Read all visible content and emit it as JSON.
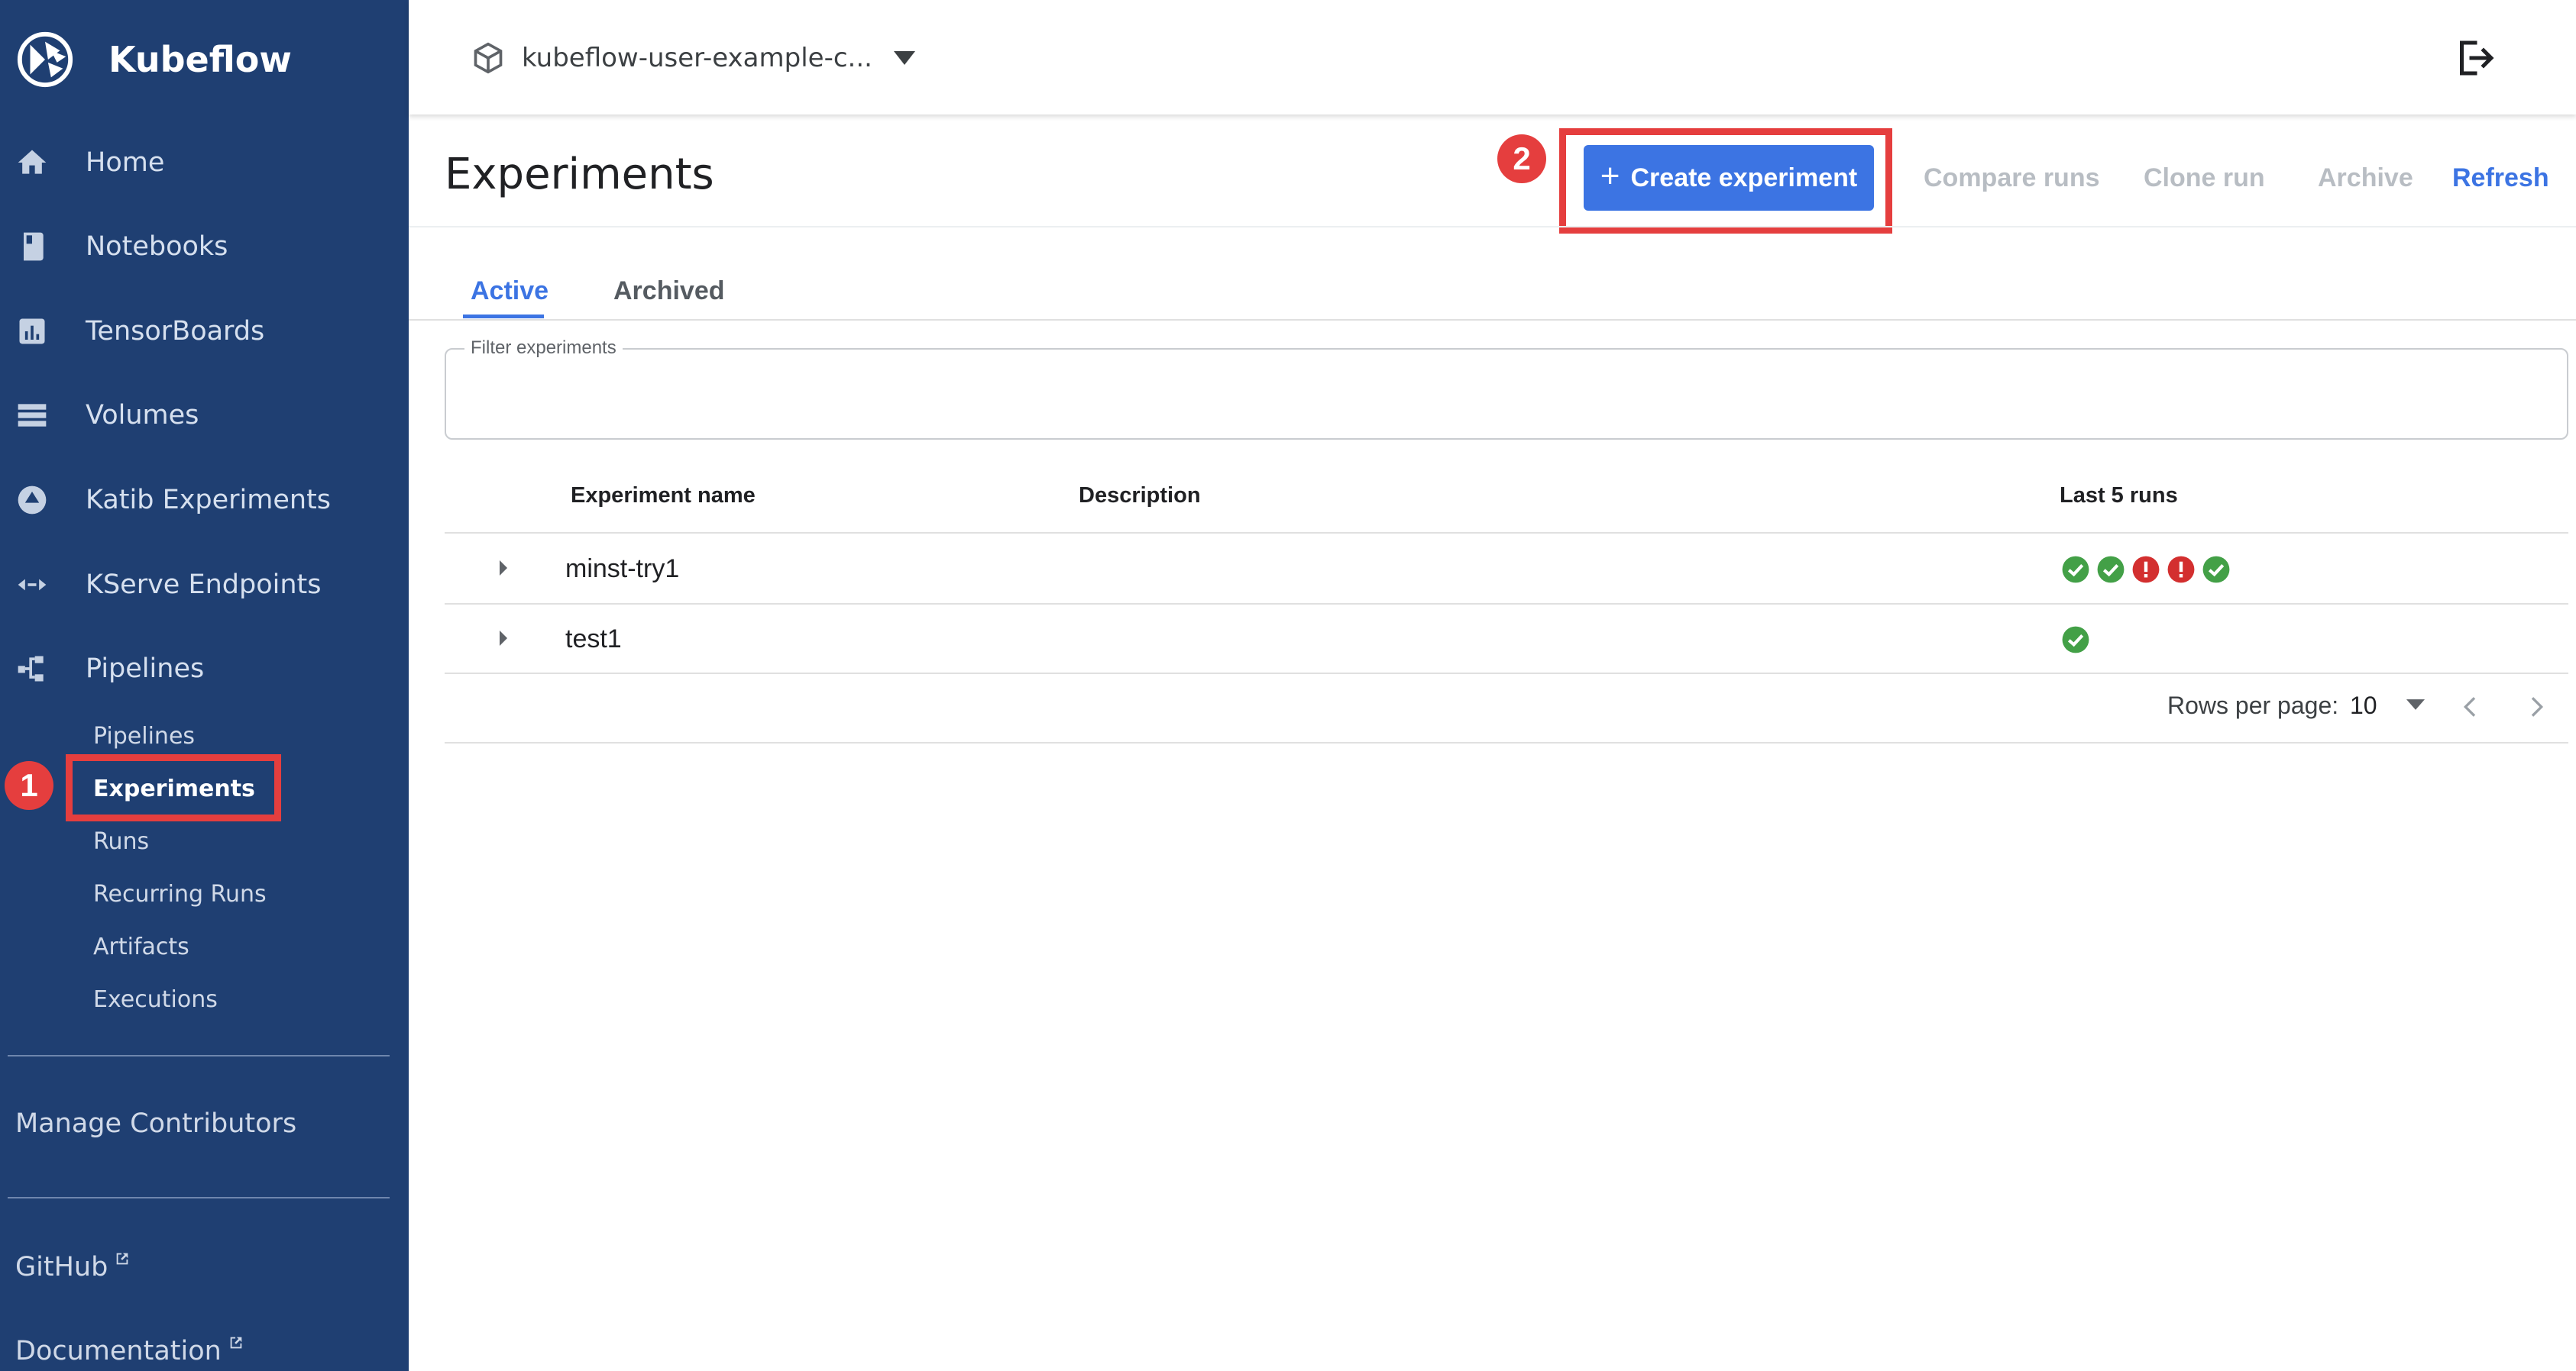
{
  "app": {
    "name": "Kubeflow"
  },
  "sidebar": {
    "items": [
      {
        "label": "Home",
        "icon": "home-icon"
      },
      {
        "label": "Notebooks",
        "icon": "notebook-icon"
      },
      {
        "label": "TensorBoards",
        "icon": "bar-chart-icon"
      },
      {
        "label": "Volumes",
        "icon": "storage-icon"
      },
      {
        "label": "Katib Experiments",
        "icon": "katib-icon"
      },
      {
        "label": "KServe Endpoints",
        "icon": "code-arrows-icon"
      },
      {
        "label": "Pipelines",
        "icon": "pipeline-icon"
      }
    ],
    "pipelines_sub": [
      {
        "label": "Pipelines"
      },
      {
        "label": "Experiments",
        "selected": true
      },
      {
        "label": "Runs"
      },
      {
        "label": "Recurring Runs"
      },
      {
        "label": "Artifacts"
      },
      {
        "label": "Executions"
      }
    ],
    "manage_contributors": "Manage Contributors",
    "github": "GitHub",
    "documentation": "Documentation"
  },
  "annotations": [
    {
      "number": "1",
      "target": "Experiments",
      "color": "#e53e3e"
    },
    {
      "number": "2",
      "target": "Create experiment",
      "color": "#e53e3e"
    }
  ],
  "topbar": {
    "namespace": "kubeflow-user-example-c...",
    "logout_icon": "logout-icon"
  },
  "page": {
    "title": "Experiments",
    "create_button": "Create experiment",
    "actions": [
      {
        "label": "Compare runs",
        "enabled": false
      },
      {
        "label": "Clone run",
        "enabled": false
      },
      {
        "label": "Archive",
        "enabled": false
      },
      {
        "label": "Refresh",
        "enabled": true
      }
    ],
    "tabs": [
      {
        "label": "Active",
        "active": true
      },
      {
        "label": "Archived",
        "active": false
      }
    ],
    "filter": {
      "label": "Filter experiments",
      "value": ""
    }
  },
  "table": {
    "columns": [
      "Experiment name",
      "Description",
      "Last 5 runs"
    ],
    "rows": [
      {
        "name": "minst-try1",
        "description": "",
        "last_runs": [
          "succeeded",
          "succeeded",
          "failed",
          "failed",
          "succeeded"
        ]
      },
      {
        "name": "test1",
        "description": "",
        "last_runs": [
          "succeeded"
        ]
      }
    ]
  },
  "pagination": {
    "rows_per_page_label": "Rows per page:",
    "rows_per_page": "10"
  },
  "colors": {
    "sidebar_bg": "#1f3f72",
    "accent": "#3c74e3",
    "success": "#43a047",
    "error": "#d32f2f",
    "annotation": "#e53e3e"
  }
}
